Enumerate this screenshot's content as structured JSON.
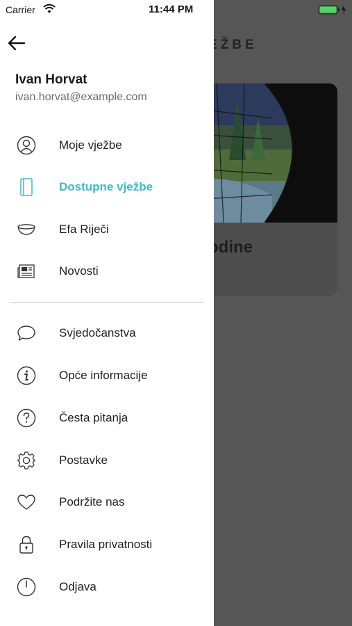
{
  "status_bar": {
    "carrier": "Carrier",
    "time": "11:44 PM"
  },
  "background": {
    "header_fragment": "EŽBE",
    "card_title_fragment": "odine"
  },
  "user": {
    "name": "Ivan Horvat",
    "email": "ivan.horvat@example.com"
  },
  "menu": {
    "primary": [
      {
        "label": "Moje vježbe",
        "icon": "person-icon",
        "active": false
      },
      {
        "label": "Dostupne vježbe",
        "icon": "notebook-icon",
        "active": true
      },
      {
        "label": "Efa Riječi",
        "icon": "bowl-icon",
        "active": false
      },
      {
        "label": "Novosti",
        "icon": "newspaper-icon",
        "active": false
      }
    ],
    "secondary": [
      {
        "label": "Svjedočanstva",
        "icon": "speech-bubble-icon"
      },
      {
        "label": "Opće informacije",
        "icon": "info-icon"
      },
      {
        "label": "Česta pitanja",
        "icon": "question-icon"
      },
      {
        "label": "Postavke",
        "icon": "gear-icon"
      },
      {
        "label": "Podržite nas",
        "icon": "heart-icon"
      },
      {
        "label": "Pravila privatnosti",
        "icon": "lock-icon"
      },
      {
        "label": "Odjava",
        "icon": "power-icon"
      }
    ]
  },
  "colors": {
    "accent": "#3bbcc9",
    "battery": "#4cd964",
    "overlay": "#565656"
  }
}
